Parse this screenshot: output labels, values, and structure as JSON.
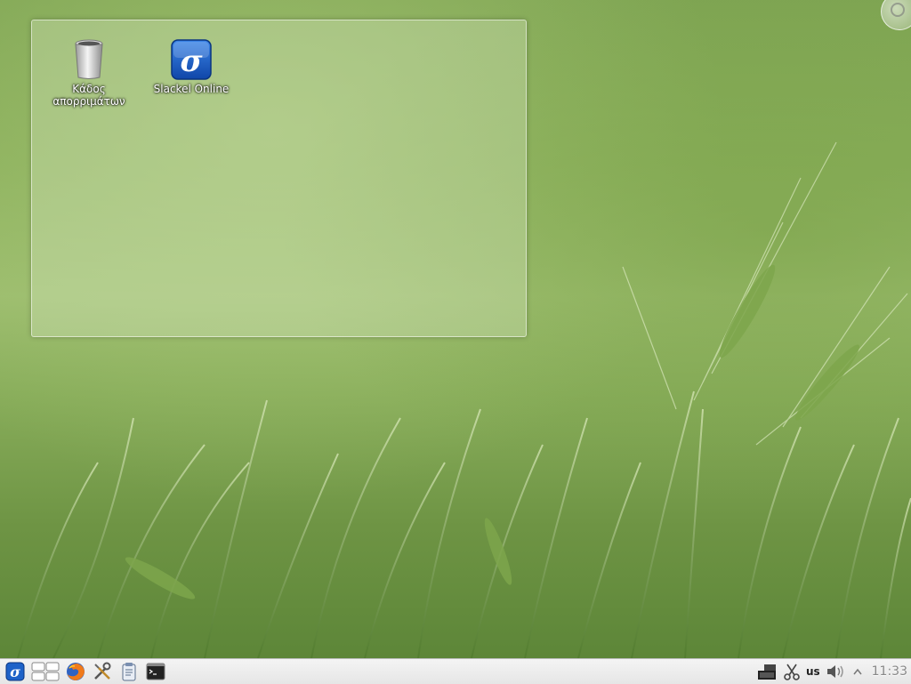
{
  "desktop": {
    "icons": [
      {
        "label": "Κάδος απορριμάτων",
        "icon": "trash-icon"
      },
      {
        "label": "Slackel Online",
        "icon": "slackel-icon"
      }
    ]
  },
  "taskbar": {
    "launchers": [
      {
        "icon": "slackel-menu-icon"
      },
      {
        "icon": "pager-icon"
      },
      {
        "icon": "firefox-icon"
      },
      {
        "icon": "settings-tools-icon"
      },
      {
        "icon": "clipboard-icon"
      },
      {
        "icon": "terminal-icon"
      }
    ],
    "tray": {
      "keyboard_layout": "us",
      "clock": "11:33"
    }
  },
  "colors": {
    "accent_blue": "#1e62c8",
    "taskbar_bg": "#eeeeee"
  }
}
